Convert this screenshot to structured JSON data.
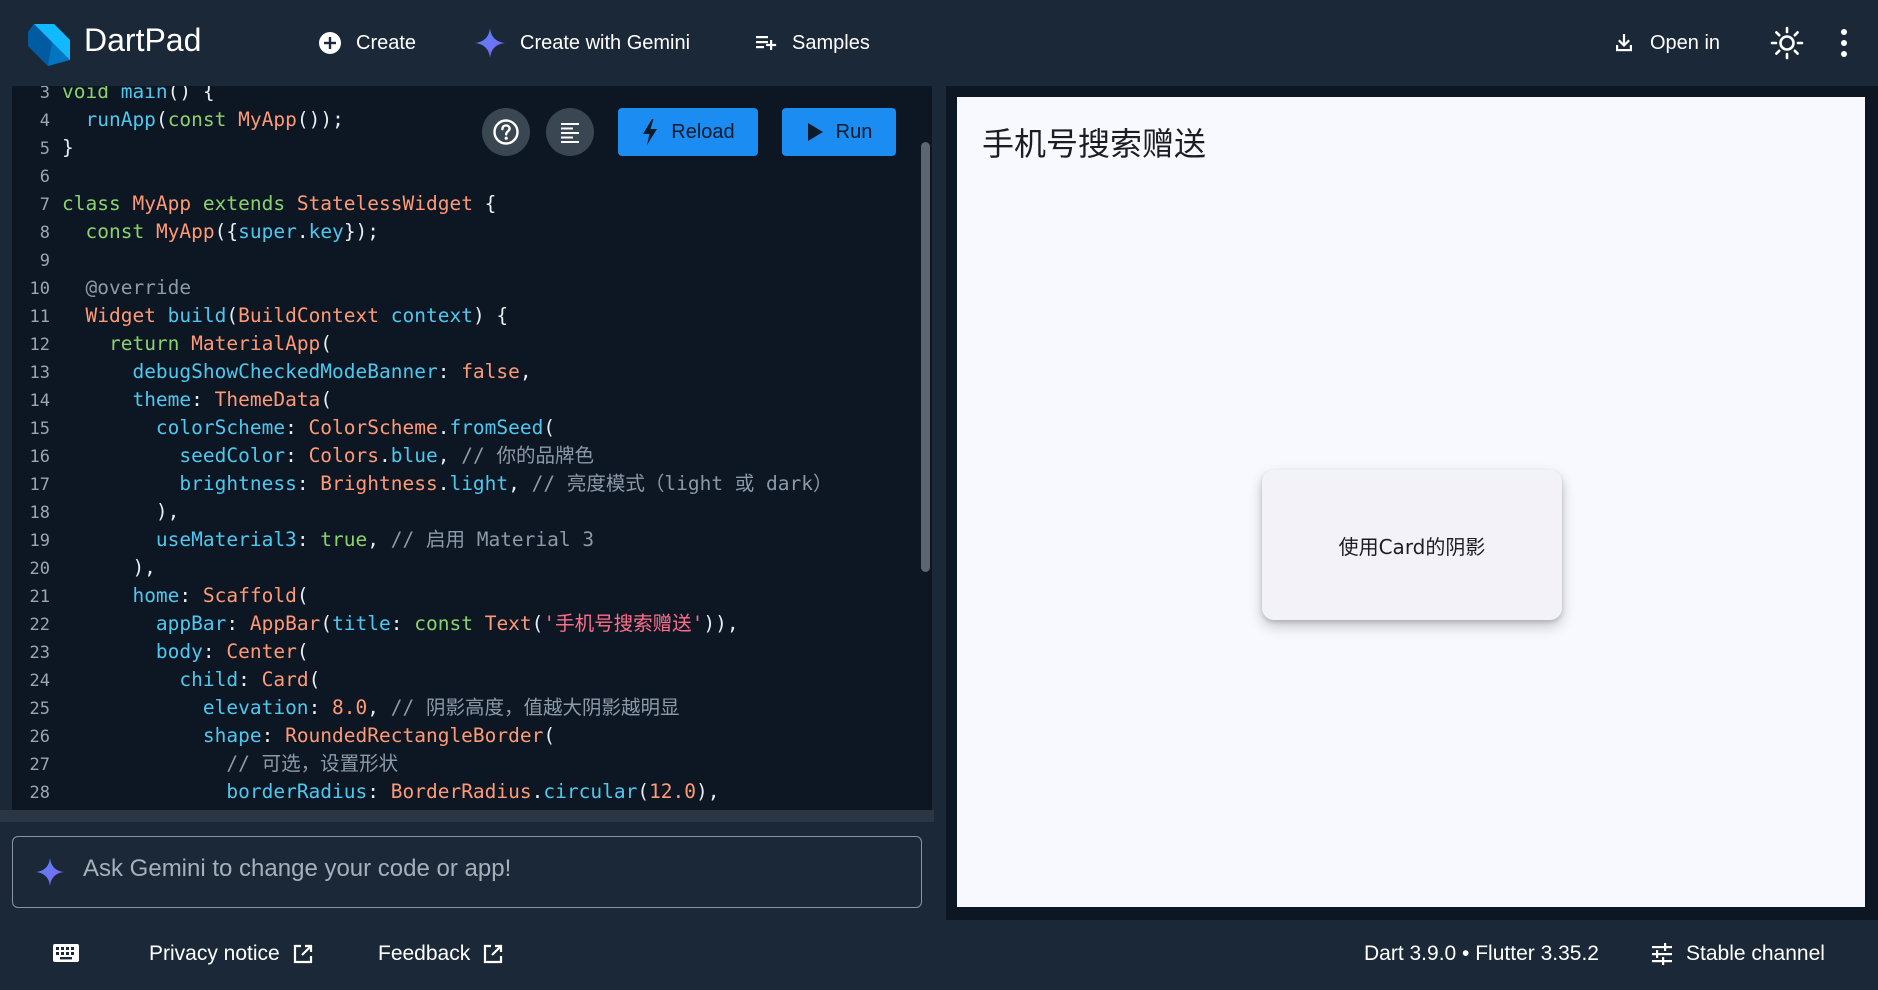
{
  "header": {
    "title": "DartPad",
    "create_label": "Create",
    "gemini_label": "Create with Gemini",
    "samples_label": "Samples",
    "open_in_label": "Open in"
  },
  "editor": {
    "reload_label": "Reload",
    "run_label": "Run",
    "lines": [
      {
        "n": "3",
        "tokens": [
          [
            "kw",
            "void "
          ],
          [
            "prop",
            "main"
          ],
          [
            "",
            "() {"
          ]
        ]
      },
      {
        "n": "4",
        "tokens": [
          [
            "",
            "  "
          ],
          [
            "prop",
            "runApp"
          ],
          [
            "",
            "("
          ],
          [
            "kw",
            "const "
          ],
          [
            "cls",
            "MyApp"
          ],
          [
            "",
            "());"
          ]
        ]
      },
      {
        "n": "5",
        "tokens": [
          [
            "",
            "}"
          ]
        ]
      },
      {
        "n": "6",
        "tokens": []
      },
      {
        "n": "7",
        "tokens": [
          [
            "kw",
            "class "
          ],
          [
            "cls",
            "MyApp "
          ],
          [
            "kw",
            "extends "
          ],
          [
            "cls",
            "StatelessWidget "
          ],
          [
            "",
            "{"
          ]
        ]
      },
      {
        "n": "8",
        "tokens": [
          [
            "",
            "  "
          ],
          [
            "kw",
            "const "
          ],
          [
            "cls",
            "MyApp"
          ],
          [
            "",
            "({"
          ],
          [
            "prop",
            "super"
          ],
          [
            "",
            "."
          ],
          [
            "prop",
            "key"
          ],
          [
            "",
            "});"
          ]
        ]
      },
      {
        "n": "9",
        "tokens": []
      },
      {
        "n": "10",
        "tokens": [
          [
            "cmt",
            "  @override"
          ]
        ]
      },
      {
        "n": "11",
        "tokens": [
          [
            "",
            "  "
          ],
          [
            "cls",
            "Widget "
          ],
          [
            "prop",
            "build"
          ],
          [
            "",
            "("
          ],
          [
            "cls",
            "BuildContext "
          ],
          [
            "prop",
            "context"
          ],
          [
            "",
            ") {"
          ]
        ]
      },
      {
        "n": "12",
        "tokens": [
          [
            "",
            "    "
          ],
          [
            "kw",
            "return "
          ],
          [
            "cls",
            "MaterialApp"
          ],
          [
            "",
            "("
          ]
        ]
      },
      {
        "n": "13",
        "tokens": [
          [
            "",
            "      "
          ],
          [
            "prop",
            "debugShowCheckedModeBanner"
          ],
          [
            "",
            ": "
          ],
          [
            "num",
            "false"
          ],
          [
            "",
            ","
          ]
        ]
      },
      {
        "n": "14",
        "tokens": [
          [
            "",
            "      "
          ],
          [
            "prop",
            "theme"
          ],
          [
            "",
            ": "
          ],
          [
            "cls",
            "ThemeData"
          ],
          [
            "",
            "("
          ]
        ]
      },
      {
        "n": "15",
        "tokens": [
          [
            "",
            "        "
          ],
          [
            "prop",
            "colorScheme"
          ],
          [
            "",
            ": "
          ],
          [
            "cls",
            "ColorScheme"
          ],
          [
            "",
            "."
          ],
          [
            "prop",
            "fromSeed"
          ],
          [
            "",
            "("
          ]
        ]
      },
      {
        "n": "16",
        "tokens": [
          [
            "",
            "          "
          ],
          [
            "prop",
            "seedColor"
          ],
          [
            "",
            ": "
          ],
          [
            "cls",
            "Colors"
          ],
          [
            "",
            "."
          ],
          [
            "prop",
            "blue"
          ],
          [
            "",
            ", "
          ],
          [
            "cmt",
            "// 你的品牌色"
          ]
        ]
      },
      {
        "n": "17",
        "tokens": [
          [
            "",
            "          "
          ],
          [
            "prop",
            "brightness"
          ],
          [
            "",
            ": "
          ],
          [
            "cls",
            "Brightness"
          ],
          [
            "",
            "."
          ],
          [
            "prop",
            "light"
          ],
          [
            "",
            ", "
          ],
          [
            "cmt",
            "// 亮度模式（light 或 dark）"
          ]
        ]
      },
      {
        "n": "18",
        "tokens": [
          [
            "",
            "        ),"
          ]
        ]
      },
      {
        "n": "19",
        "tokens": [
          [
            "",
            "        "
          ],
          [
            "prop",
            "useMaterial3"
          ],
          [
            "",
            ": "
          ],
          [
            "kw",
            "true"
          ],
          [
            "",
            ", "
          ],
          [
            "cmt",
            "// 启用 Material 3"
          ]
        ]
      },
      {
        "n": "20",
        "tokens": [
          [
            "",
            "      ),"
          ]
        ]
      },
      {
        "n": "21",
        "tokens": [
          [
            "",
            "      "
          ],
          [
            "prop",
            "home"
          ],
          [
            "",
            ": "
          ],
          [
            "cls",
            "Scaffold"
          ],
          [
            "",
            "("
          ]
        ]
      },
      {
        "n": "22",
        "tokens": [
          [
            "",
            "        "
          ],
          [
            "prop",
            "appBar"
          ],
          [
            "",
            ": "
          ],
          [
            "cls",
            "AppBar"
          ],
          [
            "",
            "("
          ],
          [
            "prop",
            "title"
          ],
          [
            "",
            ": "
          ],
          [
            "kw",
            "const "
          ],
          [
            "cls",
            "Text"
          ],
          [
            "",
            "("
          ],
          [
            "str",
            "'手机号搜索赠送'"
          ],
          [
            "",
            ")),"
          ]
        ]
      },
      {
        "n": "23",
        "tokens": [
          [
            "",
            "        "
          ],
          [
            "prop",
            "body"
          ],
          [
            "",
            ": "
          ],
          [
            "cls",
            "Center"
          ],
          [
            "",
            "("
          ]
        ]
      },
      {
        "n": "24",
        "tokens": [
          [
            "",
            "          "
          ],
          [
            "prop",
            "child"
          ],
          [
            "",
            ": "
          ],
          [
            "cls",
            "Card"
          ],
          [
            "",
            "("
          ]
        ]
      },
      {
        "n": "25",
        "tokens": [
          [
            "",
            "            "
          ],
          [
            "prop",
            "elevation"
          ],
          [
            "",
            ": "
          ],
          [
            "num",
            "8.0"
          ],
          [
            "",
            ", "
          ],
          [
            "cmt",
            "// 阴影高度，值越大阴影越明显"
          ]
        ]
      },
      {
        "n": "26",
        "tokens": [
          [
            "",
            "            "
          ],
          [
            "prop",
            "shape"
          ],
          [
            "",
            ": "
          ],
          [
            "cls",
            "RoundedRectangleBorder"
          ],
          [
            "",
            "("
          ]
        ]
      },
      {
        "n": "27",
        "tokens": [
          [
            "",
            "              "
          ],
          [
            "cmt",
            "// 可选，设置形状"
          ]
        ]
      },
      {
        "n": "28",
        "tokens": [
          [
            "",
            "              "
          ],
          [
            "prop",
            "borderRadius"
          ],
          [
            "",
            ": "
          ],
          [
            "cls",
            "BorderRadius"
          ],
          [
            "",
            "."
          ],
          [
            "prop",
            "circular"
          ],
          [
            "",
            "("
          ],
          [
            "num",
            "12.0"
          ],
          [
            "",
            "),"
          ]
        ]
      }
    ]
  },
  "prompt": {
    "placeholder": "Ask Gemini to change your code or app!"
  },
  "preview": {
    "appbar_title": "手机号搜索赠送",
    "card_text": "使用Card的阴影"
  },
  "footer": {
    "privacy_label": "Privacy notice",
    "feedback_label": "Feedback",
    "version_label": "Dart 3.9.0 • Flutter 3.35.2",
    "channel_label": "Stable channel"
  },
  "colors": {
    "accent": "#1b8cf2",
    "header_bg": "#1b2838",
    "editor_bg": "#0d1623"
  }
}
